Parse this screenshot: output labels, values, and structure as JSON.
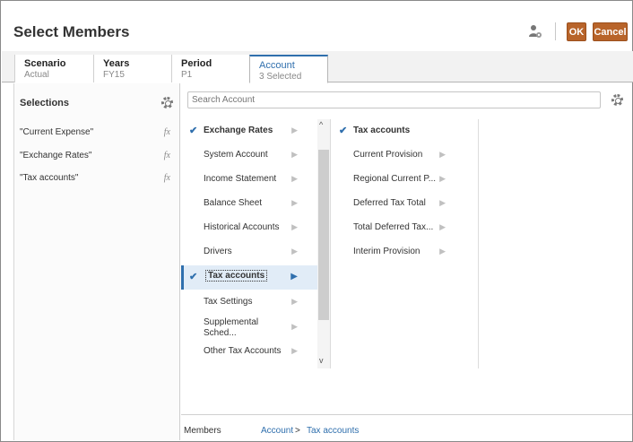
{
  "dialog": {
    "title": "Select Members",
    "ok_label": "OK",
    "cancel_label": "Cancel",
    "header_icon": "user-settings-icon"
  },
  "tabs": [
    {
      "name": "Scenario",
      "value": "Actual"
    },
    {
      "name": "Years",
      "value": "FY15"
    },
    {
      "name": "Period",
      "value": "P1"
    },
    {
      "name": "Account",
      "value": "3 Selected"
    }
  ],
  "selections": {
    "title": "Selections",
    "items": [
      {
        "label": "\"Current Expense\"",
        "fx": "fx"
      },
      {
        "label": "\"Exchange Rates\"",
        "fx": "fx"
      },
      {
        "label": "\"Tax accounts\"",
        "fx": "fx"
      }
    ]
  },
  "search": {
    "placeholder": "Search Account"
  },
  "column1": [
    {
      "label": "Exchange Rates",
      "checked": true
    },
    {
      "label": "System Account",
      "checked": false
    },
    {
      "label": "Income Statement",
      "checked": false
    },
    {
      "label": "Balance Sheet",
      "checked": false
    },
    {
      "label": "Historical Accounts",
      "checked": false
    },
    {
      "label": "Drivers",
      "checked": false
    },
    {
      "label": "Tax accounts",
      "checked": true
    },
    {
      "label": "Tax Settings",
      "checked": false
    },
    {
      "label": "Supplemental Sched...",
      "checked": false
    },
    {
      "label": "Other Tax Accounts",
      "checked": false
    }
  ],
  "column2": [
    {
      "label": "Tax accounts",
      "checked": true
    },
    {
      "label": "Current Provision",
      "checked": false
    },
    {
      "label": "Regional Current P...",
      "checked": false
    },
    {
      "label": "Deferred Tax Total",
      "checked": false
    },
    {
      "label": "Total Deferred Tax...",
      "checked": false
    },
    {
      "label": "Interim Provision",
      "checked": false
    }
  ],
  "footer": {
    "label": "Members",
    "crumb1": "Account",
    "separator": ">",
    "crumb2": "Tax accounts"
  },
  "colors": {
    "accent": "#2f6fad",
    "button": "#b8642a"
  }
}
